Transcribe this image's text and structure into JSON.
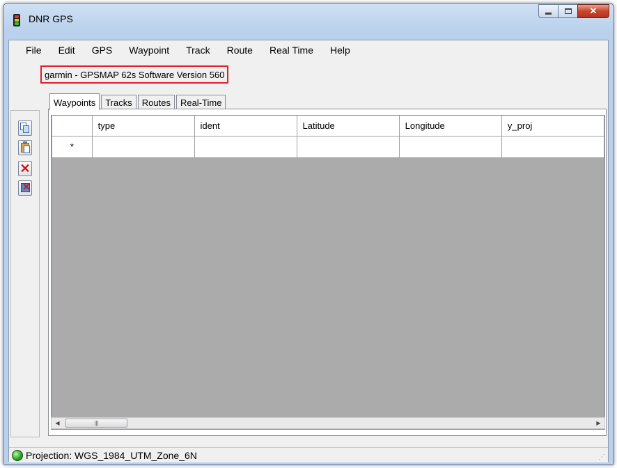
{
  "window": {
    "title": "DNR GPS"
  },
  "menu": [
    "File",
    "Edit",
    "GPS",
    "Waypoint",
    "Track",
    "Route",
    "Real Time",
    "Help"
  ],
  "device_info": "garmin - GPSMAP 62s Software Version 560",
  "tabs": [
    "Waypoints",
    "Tracks",
    "Routes",
    "Real-Time"
  ],
  "active_tab": "Waypoints",
  "grid": {
    "columns": [
      "type",
      "ident",
      "Latitude",
      "Longitude",
      "y_proj"
    ],
    "new_row_marker": "*"
  },
  "toolbar_icons": [
    "copy-icon",
    "paste-icon",
    "delete-icon",
    "delete-all-icon"
  ],
  "scroll_thumb_grip": "|||",
  "status": {
    "text": "Projection: WGS_1984_UTM_Zone_6N",
    "indicator_color": "#2ea82a"
  },
  "colors": {
    "highlight_border": "#e0202a",
    "grid_background": "#ababab"
  }
}
